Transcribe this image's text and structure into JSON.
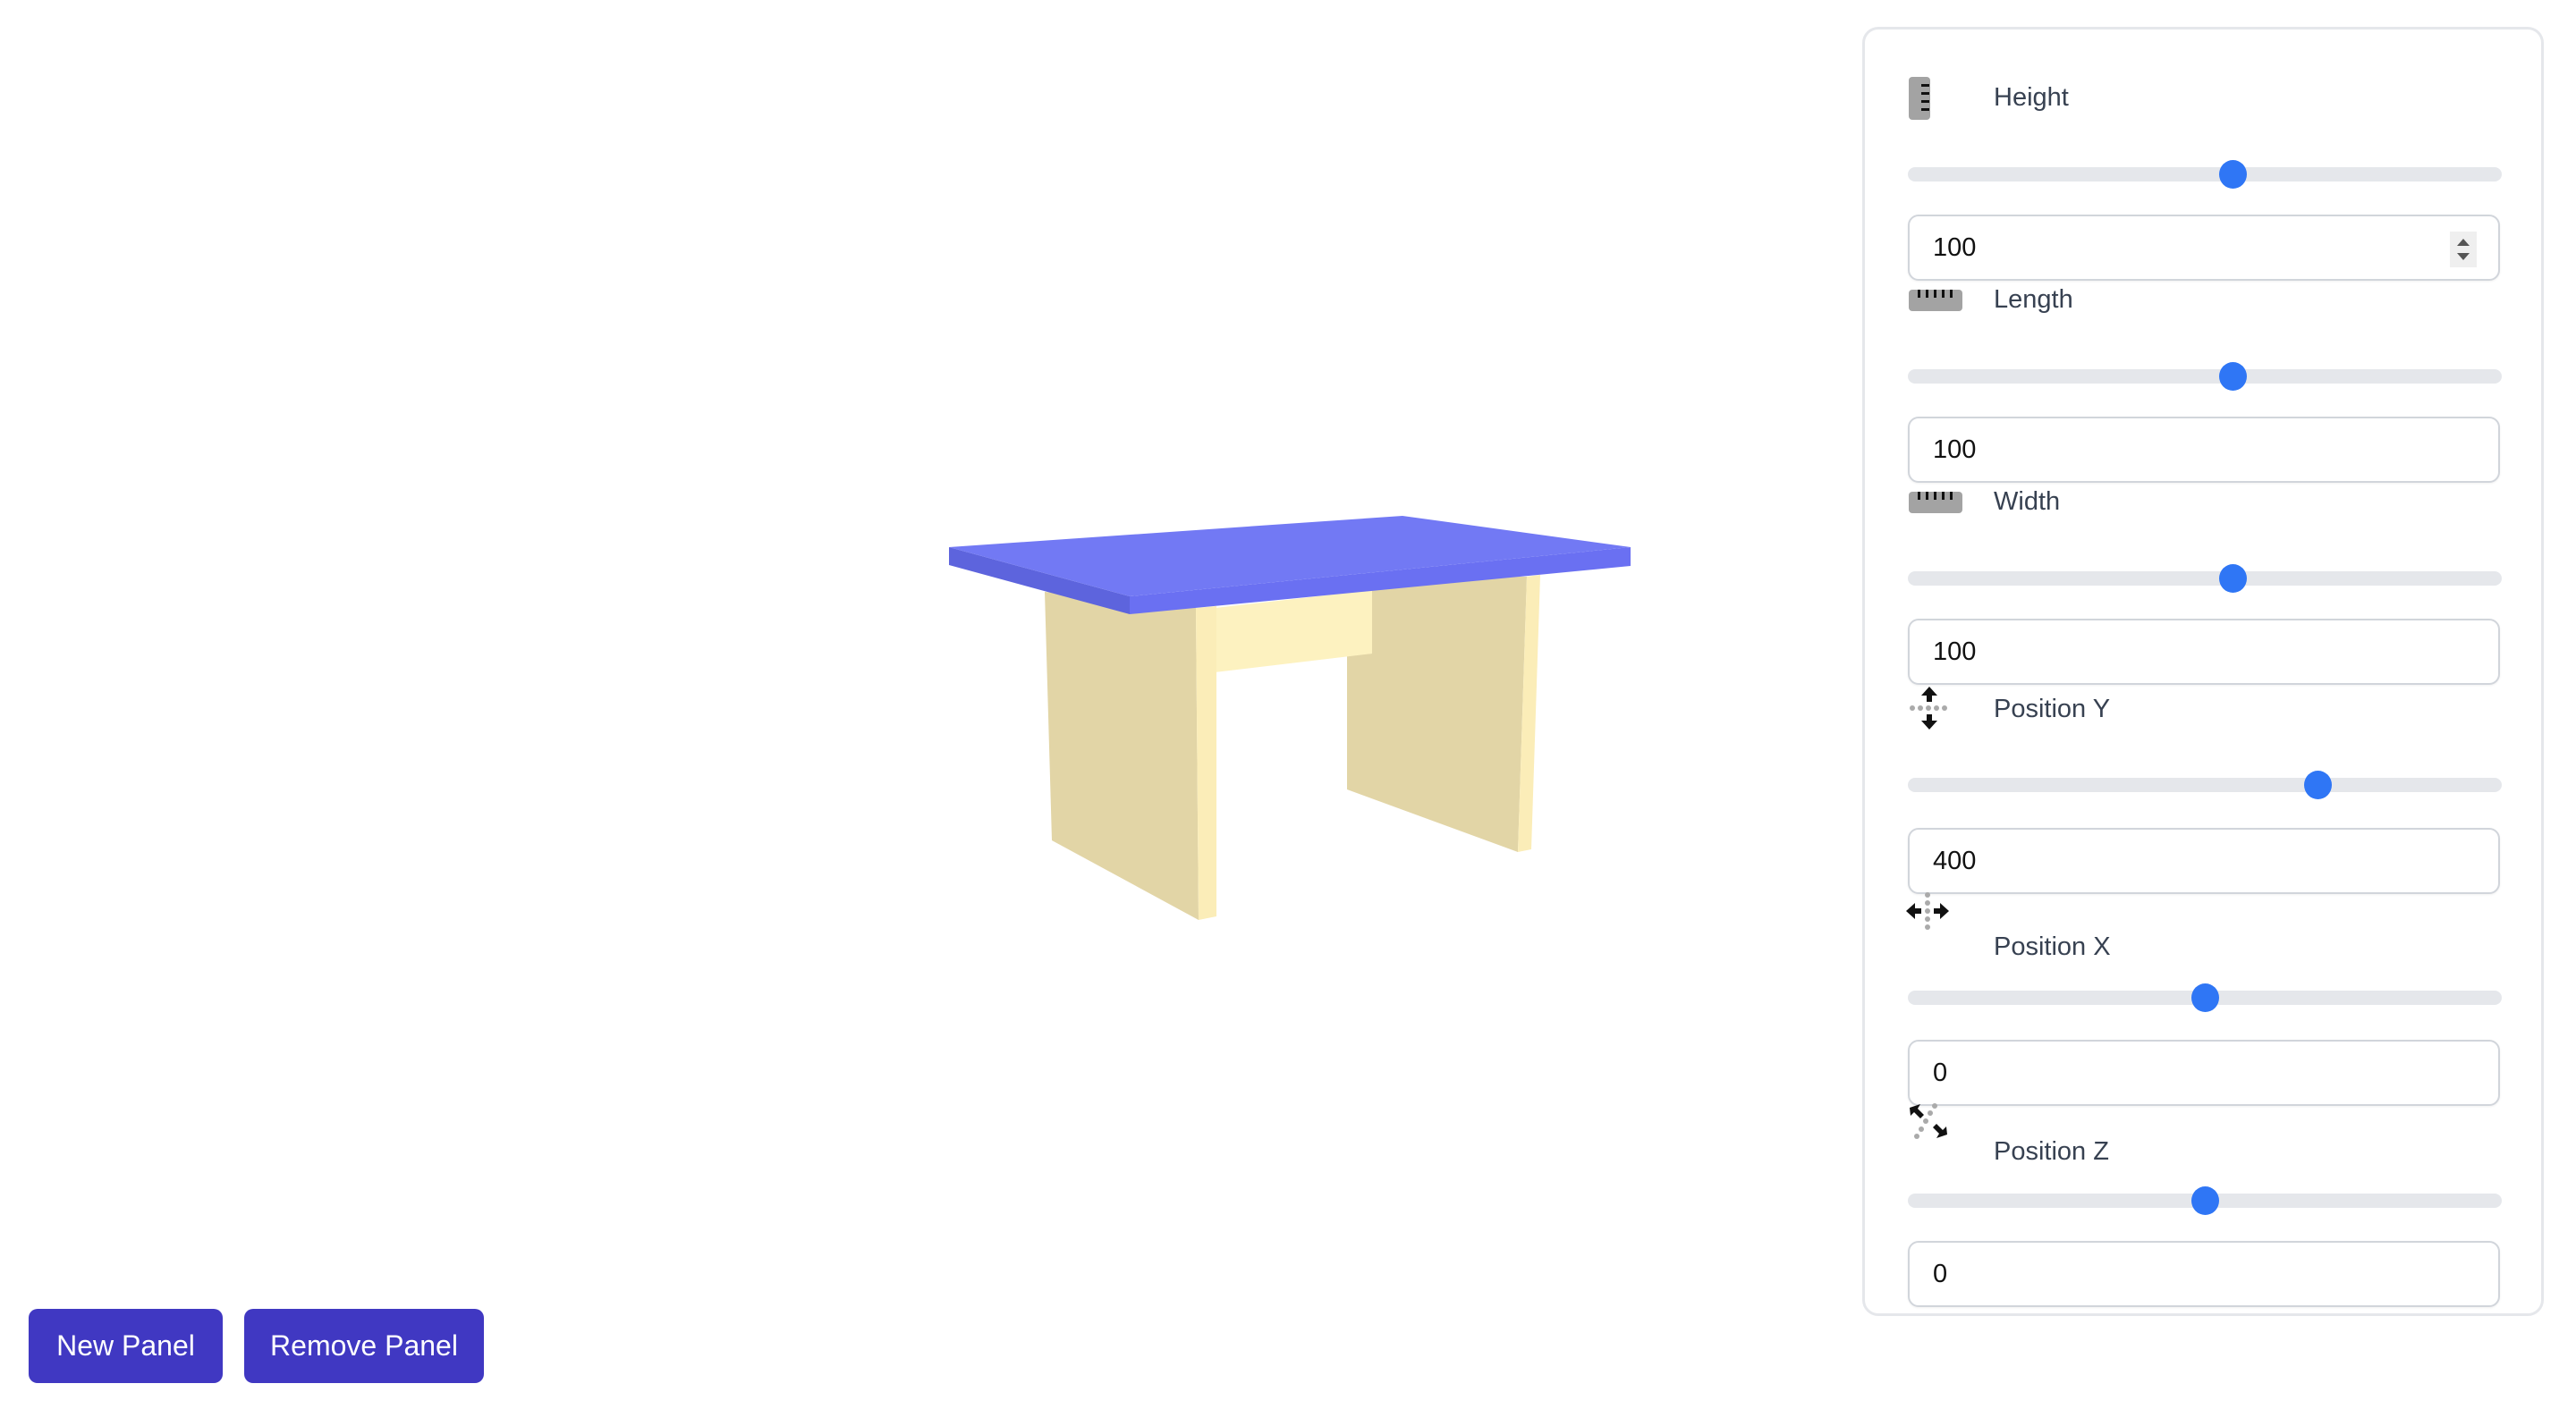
{
  "viewport": {
    "object": "table",
    "colors": {
      "top_surface": "#7279f4",
      "top_side": "#5d64dd",
      "top_front": "#6a70f2",
      "leg_face": "#e2d5a6",
      "leg_edge": "#fbedb8",
      "back_panel": "#fdf2c0"
    }
  },
  "buttons": {
    "new_panel": "New Panel",
    "remove_panel": "Remove Panel"
  },
  "controls": [
    {
      "id": "height",
      "label": "Height",
      "icon": "ruler-vertical-icon",
      "value": "100",
      "slider_fraction": 0.55,
      "has_spinner": true
    },
    {
      "id": "length",
      "label": "Length",
      "icon": "ruler-horizontal-icon",
      "value": "100",
      "slider_fraction": 0.55,
      "has_spinner": false
    },
    {
      "id": "width",
      "label": "Width",
      "icon": "ruler-horizontal-icon",
      "value": "100",
      "slider_fraction": 0.55,
      "has_spinner": false
    },
    {
      "id": "position-y",
      "label": "Position Y",
      "icon": "move-vertical-icon",
      "value": "400",
      "slider_fraction": 0.7,
      "has_spinner": false
    },
    {
      "id": "position-x",
      "label": "Position X",
      "icon": "move-horizontal-icon",
      "value": "0",
      "slider_fraction": 0.5,
      "has_spinner": false
    },
    {
      "id": "position-z",
      "label": "Position Z",
      "icon": "move-depth-icon",
      "value": "0",
      "slider_fraction": 0.5,
      "has_spinner": false
    }
  ],
  "colors": {
    "accent": "#2f76f5",
    "button": "#4038c2",
    "track": "#e5e7eb"
  }
}
